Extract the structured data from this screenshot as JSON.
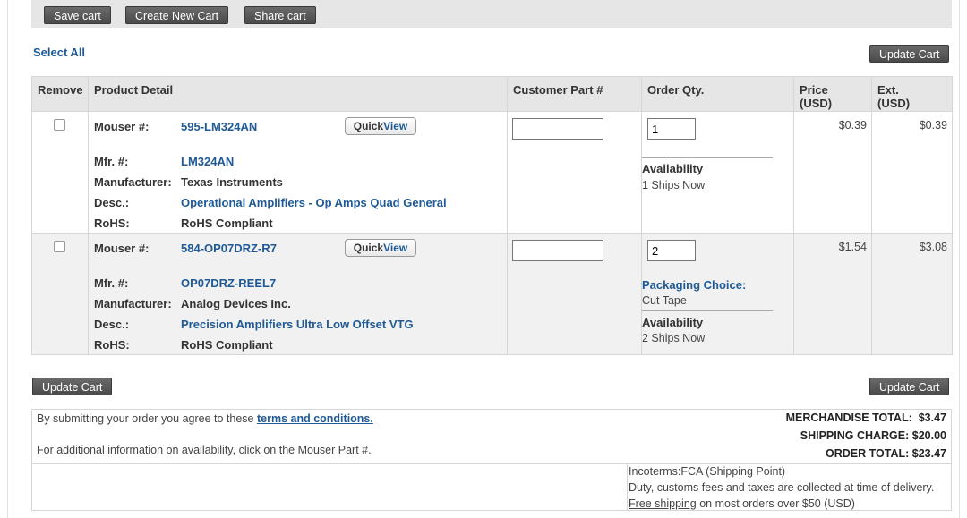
{
  "toolbar": {
    "save_cart": "Save cart",
    "create_cart": "Create New Cart",
    "share_cart": "Share cart"
  },
  "select_all": "Select All",
  "update_cart": "Update Cart",
  "table": {
    "headers": {
      "remove": "Remove",
      "product_detail": "Product Detail",
      "customer_part": "Customer Part #",
      "order_qty": "Order Qty.",
      "price": "Price\n(USD)",
      "ext": "Ext.\n(USD)"
    },
    "labels": {
      "mouser": "Mouser #:",
      "mfr": "Mfr. #:",
      "manufacturer": "Manufacturer:",
      "desc": "Desc.:",
      "rohs": "RoHS:"
    },
    "quickview": {
      "a": "Quick",
      "b": "View"
    },
    "rows": [
      {
        "mouser_no": "595-LM324AN",
        "mfr_no": "LM324AN",
        "manufacturer": "Texas Instruments",
        "desc": "Operational Amplifiers - Op Amps Quad General",
        "rohs": "RoHS Compliant",
        "qty": "1",
        "availability_label": "Availability",
        "availability": "1 Ships Now",
        "price": "$0.39",
        "ext": "$0.39"
      },
      {
        "mouser_no": "584-OP07DRZ-R7",
        "mfr_no": "OP07DRZ-REEL7",
        "manufacturer": "Analog Devices Inc.",
        "desc": "Precision Amplifiers Ultra Low Offset VTG",
        "rohs": "RoHS Compliant",
        "qty": "2",
        "packaging_label": "Packaging Choice:",
        "packaging": "Cut Tape",
        "availability_label": "Availability",
        "availability": "2 Ships Now",
        "price": "$1.54",
        "ext": "$3.08"
      }
    ]
  },
  "summary": {
    "terms_prefix": "By submitting your order you agree to these",
    "terms_link": "terms and conditions.",
    "info": "For additional information on availability, click on the Mouser Part #.",
    "merch_label": "MERCHANDISE TOTAL:",
    "merch_value": "$3.47",
    "ship_label": "SHIPPING CHARGE:",
    "ship_value": "$20.00",
    "order_label": "ORDER TOTAL:",
    "order_value": "$23.47",
    "incoterms": "Incoterms:FCA (Shipping Point)",
    "duty": "Duty, customs fees and taxes are collected at time of delivery.",
    "free_shipping_link": "Free shipping",
    "free_shipping_rest": "on most orders over $50 (USD)"
  }
}
